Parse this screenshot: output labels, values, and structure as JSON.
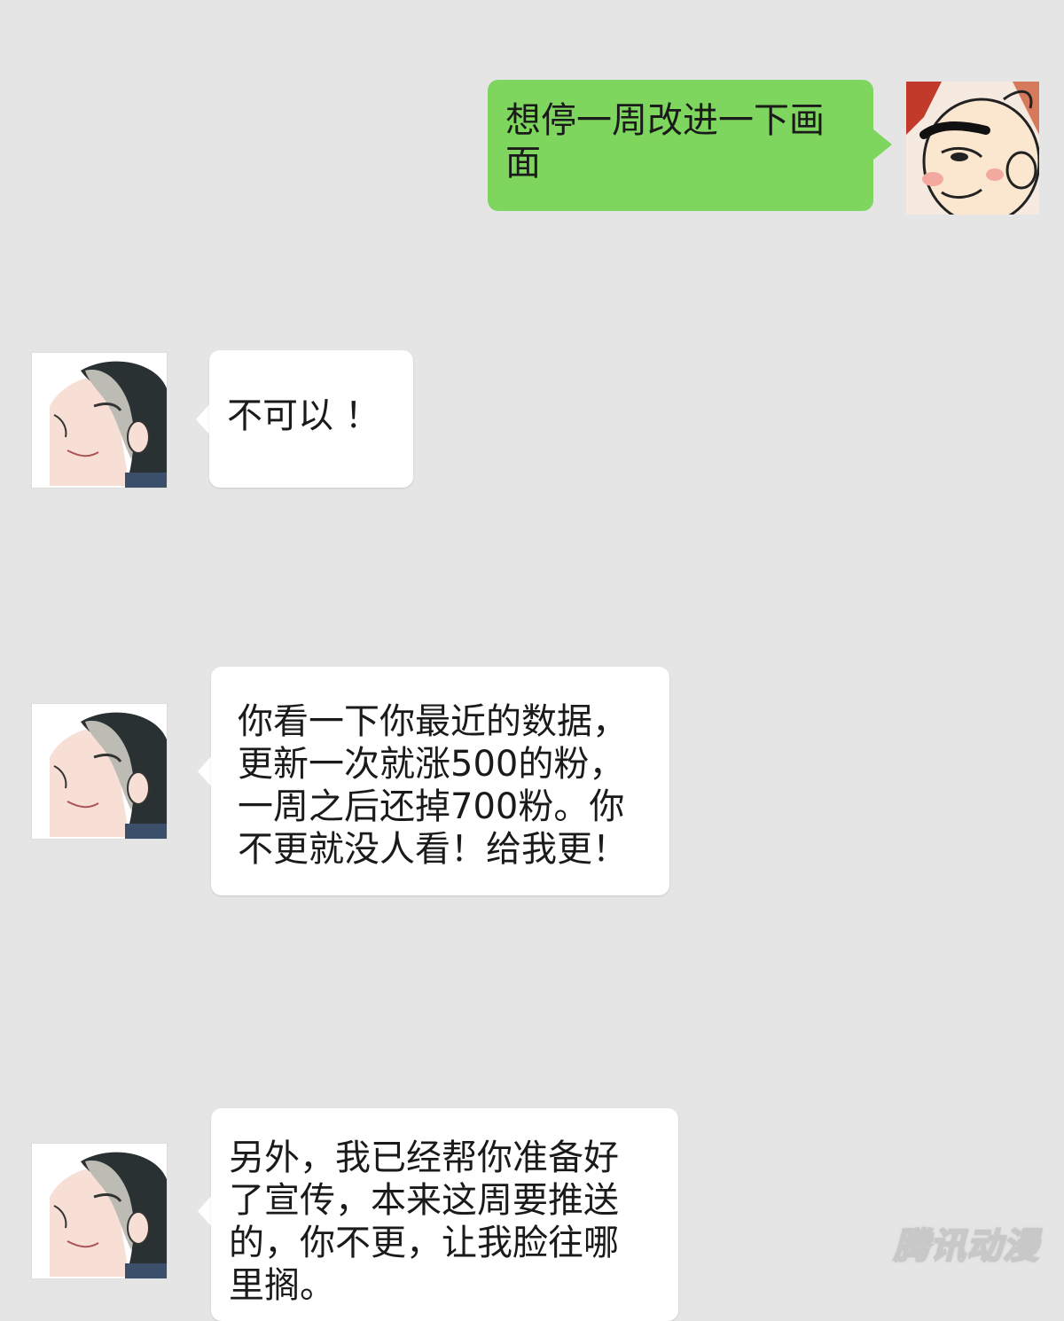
{
  "messages": [
    {
      "side": "right",
      "sender": "user",
      "text": "想停一周改进一下画面",
      "avatar": "bald-cartoon-man-avatar"
    },
    {
      "side": "left",
      "sender": "editor",
      "text": "不可以 ！",
      "avatar": "long-haired-man-avatar"
    },
    {
      "side": "left",
      "sender": "editor",
      "text": "你看一下你最近的数据，更新一次就涨500的粉，一周之后还掉700粉。你不更就没人看！给我更！",
      "avatar": "long-haired-man-avatar"
    },
    {
      "side": "left",
      "sender": "editor",
      "text": "另外，我已经帮你准备好了宣传，本来这周要推送的，你不更，让我脸往哪里搁。",
      "avatar": "long-haired-man-avatar"
    }
  ],
  "watermark": "腾讯动漫",
  "colors": {
    "background": "#e5e5e5",
    "outgoing_bubble": "#7fd65e",
    "incoming_bubble": "#ffffff",
    "text": "#1a1a1a"
  }
}
